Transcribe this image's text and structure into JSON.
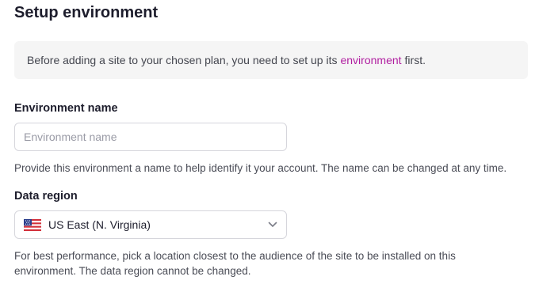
{
  "page": {
    "title": "Setup environment"
  },
  "notice": {
    "text_before": "Before adding a site to your chosen plan, you need to set up its",
    "link": "environment",
    "text_after": "first."
  },
  "env_name": {
    "label": "Environment name",
    "placeholder": "Environment name",
    "value": "",
    "help": "Provide this environment a name to help identify it your account. The name can be changed at any time."
  },
  "region": {
    "label": "Data region",
    "selected": "US East (N. Virginia)",
    "flag_icon": "us-flag-icon",
    "help": "For best performance, pick a location closest to the audience of the site to be installed on this environment. The data region cannot be changed."
  },
  "colors": {
    "accent_link": "#b01ea0"
  }
}
